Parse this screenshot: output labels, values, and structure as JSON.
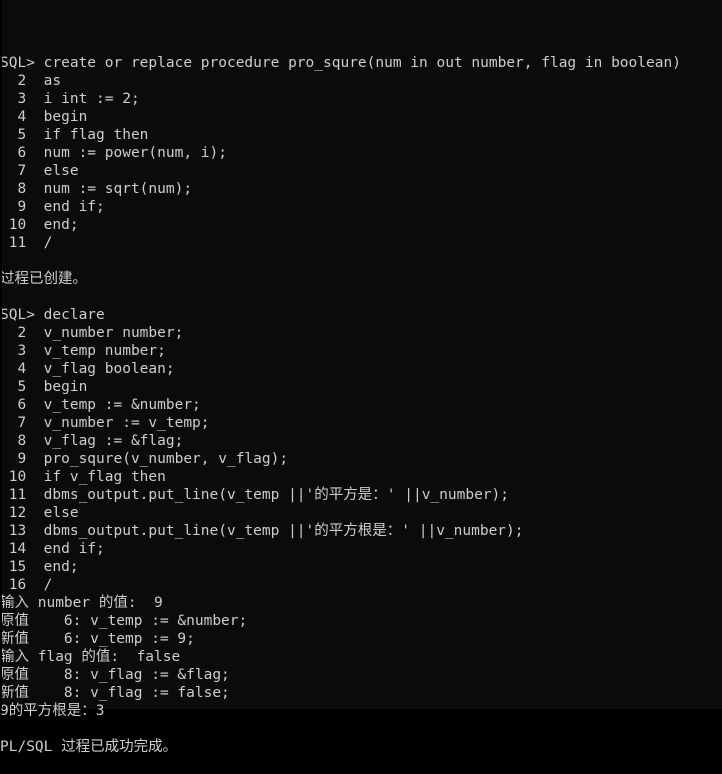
{
  "terminal": {
    "app": "SQL*Plus",
    "prompt": "SQL>",
    "colors": {
      "background": "#0b0b0b",
      "foreground": "#cdcdcd"
    },
    "lines": [
      "SQL> create or replace procedure pro_squre(num in out number, flag in boolean)",
      "  2  as",
      "  3  i int := 2;",
      "  4  begin",
      "  5  if flag then",
      "  6  num := power(num, i);",
      "  7  else",
      "  8  num := sqrt(num);",
      "  9  end if;",
      " 10  end;",
      " 11  /",
      "",
      "过程已创建。",
      "",
      "SQL> declare",
      "  2  v_number number;",
      "  3  v_temp number;",
      "  4  v_flag boolean;",
      "  5  begin",
      "  6  v_temp := &number;",
      "  7  v_number := v_temp;",
      "  8  v_flag := &flag;",
      "  9  pro_squre(v_number, v_flag);",
      " 10  if v_flag then",
      " 11  dbms_output.put_line(v_temp ||'的平方是：' ||v_number);",
      " 12  else",
      " 13  dbms_output.put_line(v_temp ||'的平方根是：' ||v_number);",
      " 14  end if;",
      " 15  end;",
      " 16  /",
      "输入 number 的值:  9",
      "原值    6: v_temp := &number;",
      "新值    6: v_temp := 9;",
      "输入 flag 的值:  false",
      "原值    8: v_flag := &flag;",
      "新值    8: v_flag := false;",
      "9的平方根是：3",
      "",
      "PL/SQL 过程已成功完成。"
    ]
  }
}
